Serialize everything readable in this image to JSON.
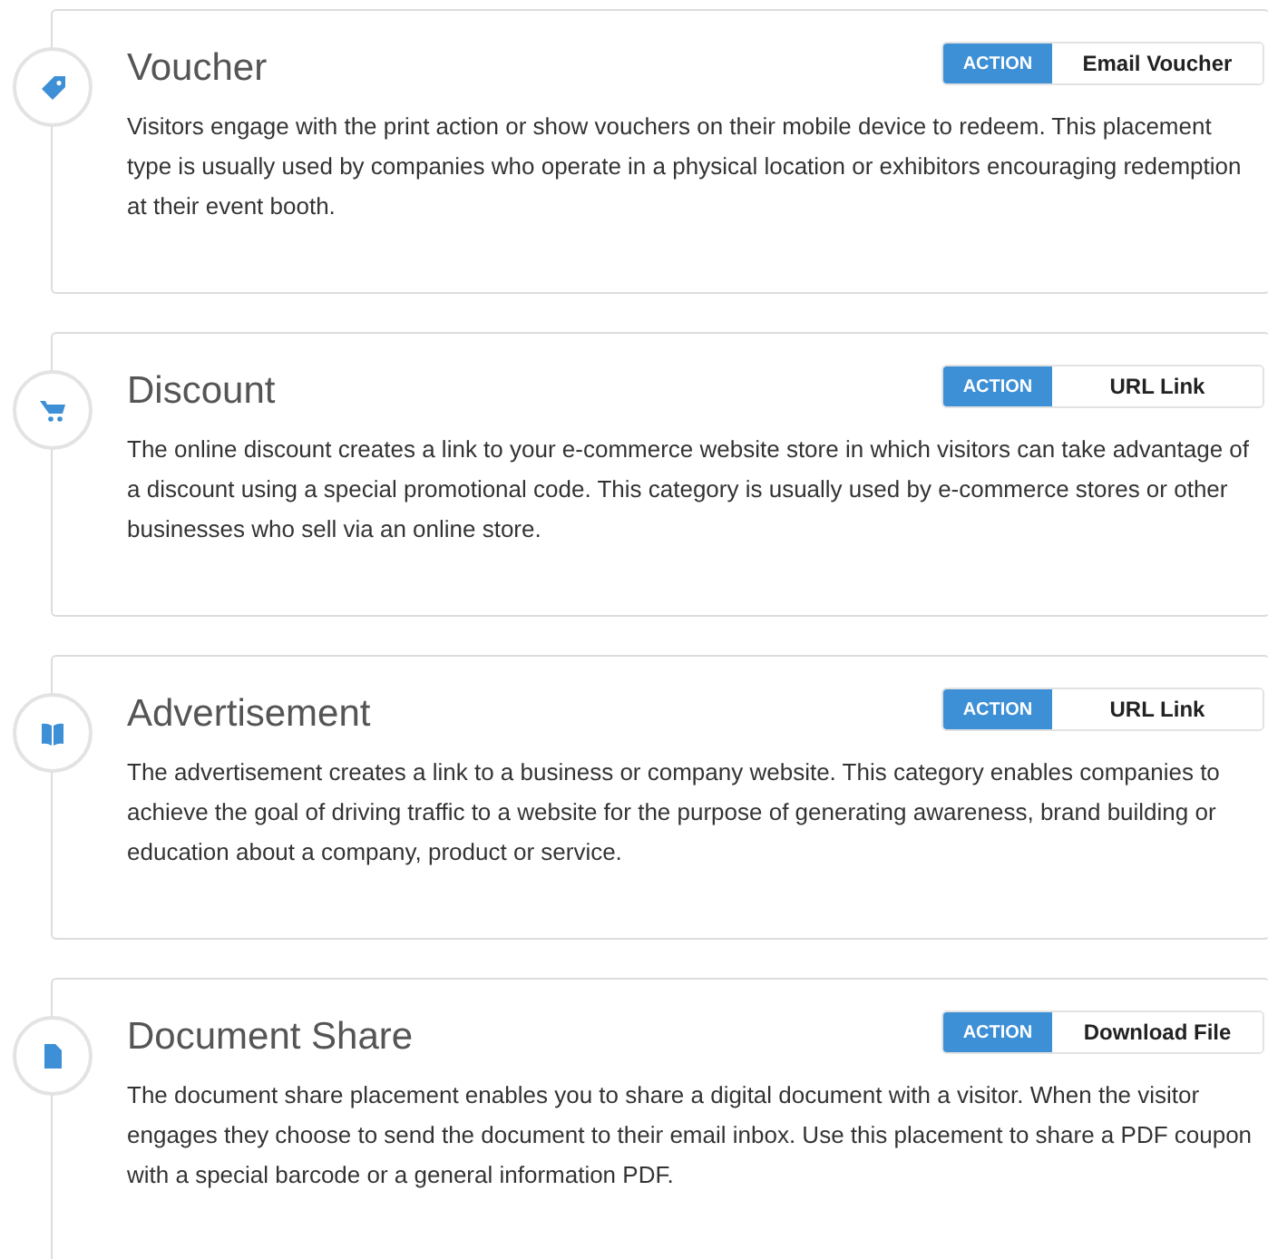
{
  "placements": [
    {
      "title": "Voucher",
      "badge": "ACTION",
      "action": "Email Voucher",
      "description": "Visitors engage with the print action or show vouchers on their mobile device to redeem. This placement type is usually used by companies who operate in a physical location or exhibitors encouraging redemption at their event booth."
    },
    {
      "title": "Discount",
      "badge": "ACTION",
      "action": "URL Link",
      "description": "The online discount creates a link to your e-commerce website store in which visitors can take advantage of a discount using a special promotional code. This category is usually used by e-commerce stores or other businesses who sell via an online store."
    },
    {
      "title": "Advertisement",
      "badge": "ACTION",
      "action": "URL Link",
      "description": "The advertisement creates a link to a business or company website. This category enables companies to achieve the goal of driving traffic to a website for the purpose of generating awareness, brand building or education about a company, product or service."
    },
    {
      "title": "Document Share",
      "badge": "ACTION",
      "action": "Download File",
      "description": "The document share placement enables you to share a digital document with a visitor. When the visitor engages they choose to send the document to their email inbox. Use this placement to share a PDF coupon with a special barcode or a general information PDF."
    }
  ]
}
